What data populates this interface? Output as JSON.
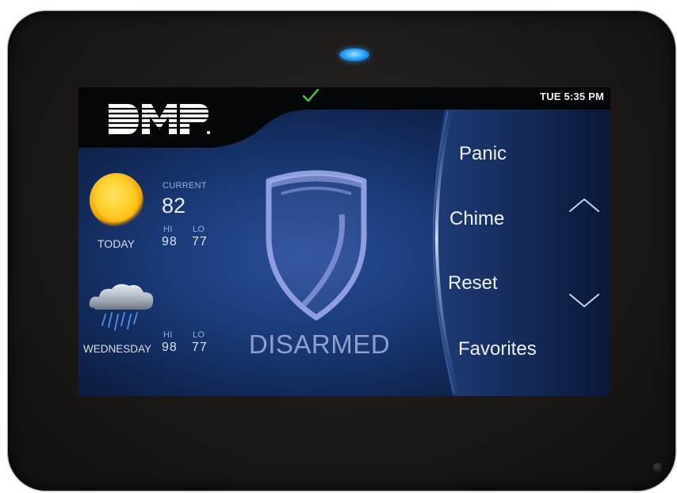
{
  "device": {
    "brand": "DMP"
  },
  "status_bar": {
    "time": "TUE 5:35 PM",
    "check_icon": "checkmark-icon"
  },
  "weather": {
    "today": {
      "icon": "sun-icon",
      "day_label": "TODAY",
      "current_label": "CURRENT",
      "current_temp": "82",
      "hi_label": "HI",
      "lo_label": "LO",
      "hi": "98",
      "lo": "77"
    },
    "next": {
      "icon": "rain-cloud-icon",
      "day_label": "WEDNESDAY",
      "hi_label": "HI",
      "lo_label": "LO",
      "hi": "98",
      "lo": "77"
    }
  },
  "system": {
    "status": "DISARMED",
    "icon": "shield-icon"
  },
  "menu": {
    "items": [
      "Panic",
      "Chime",
      "Reset",
      "Favorites"
    ],
    "up_icon": "chevron-up-icon",
    "down_icon": "chevron-down-icon"
  },
  "colors": {
    "led": "#2fa7ff",
    "status_text": "#8f9fcf",
    "check": "#4cc850"
  }
}
